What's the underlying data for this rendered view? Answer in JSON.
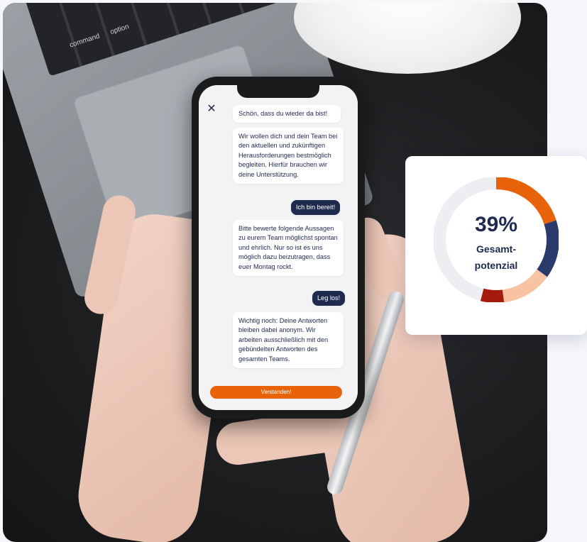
{
  "laptop": {
    "keys": [
      "command",
      "option"
    ]
  },
  "chat": {
    "messages": [
      {
        "from": "bot",
        "text": "Schön, dass du wieder da bist!"
      },
      {
        "from": "bot",
        "text": "Wir wollen dich und dein Team bei den aktuellen und zukünftigen Herausforderungen bestmöglich begleiten. Hierfür brauchen wir deine Unterstützung."
      },
      {
        "from": "user",
        "text": "Ich bin bereit!"
      },
      {
        "from": "bot",
        "text": "Bitte bewerte folgende Aussagen zu eurem Team möglichst spontan und ehrlich. Nur so ist es uns möglich dazu beizutragen, dass euer Montag rockt."
      },
      {
        "from": "user",
        "text": "Leg los!"
      },
      {
        "from": "bot",
        "text": "Wichtig noch: Deine Antworten bleiben dabei anonym. Wir arbeiten ausschließlich mit den gebündelten Antworten des gesamten Teams."
      }
    ],
    "close_icon": "close-icon",
    "cta_label": "Verstanden!"
  },
  "potential": {
    "percent_label": "39%",
    "label_line1": "Gesamt-",
    "label_line2": "potenzial",
    "segments": [
      {
        "color": "#e8620a",
        "fraction": 0.2
      },
      {
        "color": "#2a3a6b",
        "fraction": 0.15
      },
      {
        "color": "#f7c3a3",
        "fraction": 0.13
      },
      {
        "color": "#a51b0b",
        "fraction": 0.06
      },
      {
        "color": "#eceef2",
        "fraction": 0.46
      }
    ]
  },
  "colors": {
    "accent": "#e8620a",
    "navy": "#1f2a4f"
  }
}
